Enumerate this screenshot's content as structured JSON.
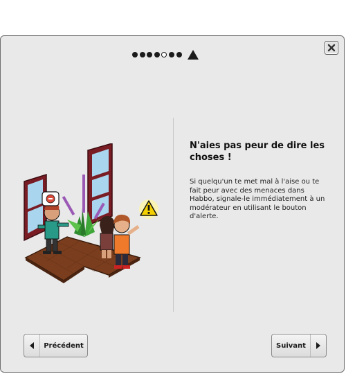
{
  "pager": {
    "dots": [
      {
        "state": "filled"
      },
      {
        "state": "filled"
      },
      {
        "state": "filled"
      },
      {
        "state": "filled"
      },
      {
        "state": "current"
      },
      {
        "state": "filled"
      },
      {
        "state": "filled"
      }
    ],
    "end_icon": "triangle-icon"
  },
  "close_icon": "close-icon",
  "content": {
    "heading": "N'aies pas peur de dire les choses !",
    "body": "Si quelqu'un te met mal à l'aise ou te fait peur avec des menaces dans Habbo, signale-le immédiatement à un modérateur en utilisant le bouton d'alerte."
  },
  "illustration": {
    "alert_icon": "warning-icon",
    "speech_icon": "angry-face-icon"
  },
  "buttons": {
    "previous": {
      "label": "Précédent",
      "icon": "arrow-left-icon"
    },
    "next": {
      "label": "Suivant",
      "icon": "arrow-right-icon"
    }
  },
  "colors": {
    "panel_bg": "#e9e9e9",
    "border": "#6f6f6f",
    "floor": "#7a3e1e",
    "alert_yellow": "#f5d000"
  }
}
